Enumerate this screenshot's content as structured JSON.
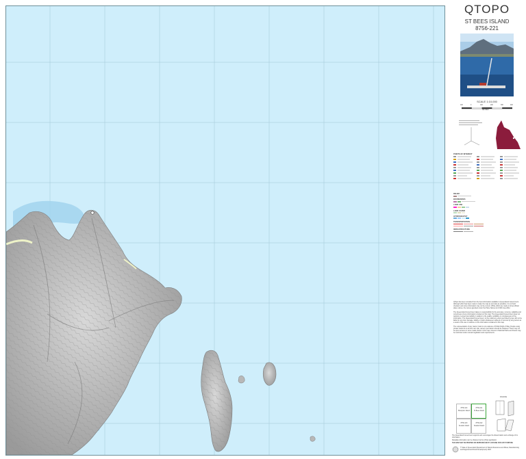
{
  "title": "QTOPO",
  "sheet_name": "ST BEES ISLAND",
  "sheet_number": "8756-221",
  "scale_label": "SCALE 1:10,000",
  "scale_ticks": [
    "100",
    "0",
    "100",
    "200",
    "300",
    "400"
  ],
  "scale_unit": "METRES",
  "colors": {
    "sea": "#cfeefb",
    "land": "#b9b9b9",
    "grid": "#9fc6d3",
    "beach": "#eef3c8",
    "qld_map": "#8b1c3c"
  },
  "legend_headings": [
    "POINTS OF INTEREST",
    "RELIEF",
    "BOUNDARIES",
    "LAND USE",
    "LAND COVER",
    "HYDROGRAPHY",
    "TRANSPORTATION",
    "INFRASTRUCTURE"
  ],
  "index_sheets": [
    {
      "num": "8756-124",
      "name": "Brampton Island"
    },
    {
      "num": "8756-221",
      "name": "St Bees Island"
    },
    {
      "num": "8756-123",
      "name": "Keswick Island"
    },
    {
      "num": "8756-222",
      "name": "Scawfell Island"
    }
  ],
  "fold_label": "FOLDING",
  "disclaimer": [
    "QTopo has been compiled from the best information available to Queensland Government. Although effort has been made to make the map as accurate as possible, it is not field checked, and some information may not be current. While efforts are made to show official place names, the names gazetted under the Place Names Act 1994 may differ.",
    "The Queensland Government takes no responsibility for the accuracy, currency, reliability and correctness of any information included on this map. The Queensland Government does not warrant or accept any liability in relation to the quality, suitability or completeness of the information. The Queensland Government, to the maximum extent permitted by law, will not be liable for any loss, damage, liability or claim whatsoever suffered or incurred by any person as a result of the use or reliance on the information contained in this map.",
    "The representation of any road or track is not evidence of Public Right of Way. People using private roads do so at their own risk, owners' permission should be obtained. There may not be open access on some roads shown in this map. Access to National Parks and forests may be restricted under relevant legislation and requirements."
  ],
  "notices": [
    "The Queensland Government supports and encourages the dissemination and exchange of its information.",
    "Metadata information can be obtained via the QTopo application",
    "THIS MAP MAY BE PRINTED OR REPRODUCED BY ANYONE FOR ANY PURPOSE"
  ],
  "copyright": "© State of Queensland (Department of Natural Resources and Mines, Manufacturing and Regional and Rural Development) 2023"
}
